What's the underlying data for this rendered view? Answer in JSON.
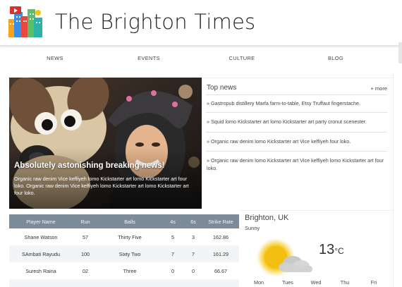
{
  "site": {
    "title": "The Brighton Times"
  },
  "nav": {
    "items": [
      "NEWS",
      "EVENTS",
      "CULTURE",
      "BLOG"
    ]
  },
  "hero": {
    "headline": "Absolutely astonishing breaking news!",
    "text": "Organic raw denim Vice keffiyeh lomo Kickstarter art lomo Kickstarter art four loko. Organic raw denim Vice keffiyeh lomo Kickstarter art lomo Kickstarter art four loko."
  },
  "top_news": {
    "title": "Top news",
    "more_label": "+ more",
    "items": [
      "» Gastropub distillery Marfa farm-to-table, Etsy Truffaut fingerstache.",
      "» Squid lomo Kickstarter art lomo Kickstarter art party cronut scenester.",
      "» Organic raw denim lomo Kickstarter art Vice keffiyeh four loko.",
      "» Organic raw denim lomo Kickstarter art Vice keffiyeh lomo Kickstarter art four loko."
    ]
  },
  "stats_table": {
    "headers": [
      "Player Name",
      "Run",
      "Balls",
      "4s",
      "6s",
      "Strike Rate"
    ],
    "rows": [
      [
        "Shane Watson",
        "57",
        "Thirty Five",
        "5",
        "3",
        "162.86"
      ],
      [
        "SAmbati Rayudu",
        "100",
        "Sixty Two",
        "7",
        "7",
        "161.29"
      ],
      [
        "Suresh Raina",
        "02",
        "Three",
        "0",
        "0",
        "66.67"
      ]
    ]
  },
  "weather": {
    "city": "Brighton, UK",
    "condition": "Sunny",
    "temperature": "13",
    "unit": "°C",
    "days": [
      "Mon",
      "Tues",
      "Wed",
      "Thu",
      "Fri"
    ],
    "icon": "sun-cloud-icon",
    "sun_color": "#f5c518",
    "cloud_color": "#cfcfcf"
  },
  "colors": {
    "table_header": "#7c8b97",
    "row_alt": "#f2f4f6"
  }
}
